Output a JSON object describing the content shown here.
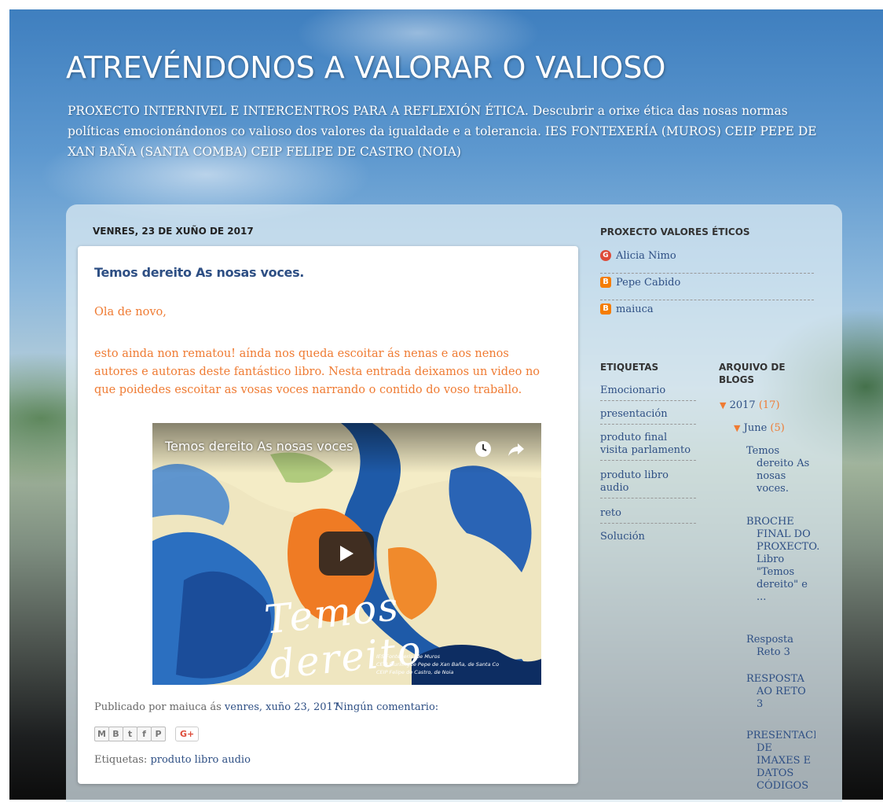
{
  "header": {
    "title": "ATREVÉNDONOS A VALORAR O VALIOSO",
    "description": "PROXECTO INTERNIVEL E INTERCENTROS PARA A REFLEXIÓN ÉTICA. Descubrir a orixe ética das nosas normas políticas emocionándonos co valioso dos valores da igualdade e a tolerancia. IES FONTEXERÍA (MUROS) CEIP PEPE DE XAN BAÑA (SANTA COMBA) CEIP FELIPE DE CASTRO (NOIA)"
  },
  "post": {
    "date_header": "VENRES, 23 DE XUÑO DE 2017",
    "title": "Temos dereito As nosas voces.",
    "paragraph1": "Ola de novo,",
    "paragraph2": "esto ainda non rematou! aínda nos queda escoitar ás nenas e aos nenos autores e autoras deste fantástico libro. Nesta entrada deixamos un video no que poidedes escoitar as vosas voces narrando o contido do voso traballo.",
    "video": {
      "title": "Temos dereito As nosas voces",
      "script_text": "Temos dereito",
      "credit1": "IES Fontexería, de Muros",
      "credit2": "CEIP Plurilingüe Pepe de Xan Baña, de Santa Co",
      "credit3": "CEIP Felipe de Castro, de Noia"
    },
    "footer": {
      "published_by": "Publicado por maiuca ás",
      "date_link": "venres, xuño 23, 2017",
      "comments": "Ningún comentario:"
    },
    "share_buttons": [
      "M",
      "B",
      "t",
      "f",
      "P"
    ],
    "gplus": "G+",
    "labels_prefix": "Etiquetas:",
    "labels_link": "produto libro audio"
  },
  "sidebar": {
    "authors_heading": "PROXECTO VALORES ÉTICOS",
    "authors": [
      {
        "name": "Alicia Nimo",
        "icon": "google-plus-icon"
      },
      {
        "name": "Pepe Cabido",
        "icon": "blogger-icon"
      },
      {
        "name": "maiuca",
        "icon": "blogger-icon"
      }
    ],
    "labels_heading": "ETIQUETAS",
    "labels": [
      "Emocionario",
      "presentación",
      "produto final visita parlamento",
      "produto libro audio",
      "reto",
      "Solución"
    ],
    "archive_heading": "ARQUIVO DE BLOGS",
    "archive": {
      "year": "2017",
      "year_count": "(17)",
      "month": "June",
      "month_count": "(5)",
      "posts": [
        "Temos dereito As nosas voces.",
        "BROCHE FINAL DO PROXECTO. Libro \"Temos dereito\" e ...",
        "Resposta Reto 3",
        "RESPOSTA AO RETO 3",
        "PRESENTACIÓN DE IMAXES E DATOS CÓDIGOS"
      ]
    }
  },
  "colors": {
    "link": "#2e4f84",
    "accent_orange": "#ef7b33",
    "post_bg": "#ffffff"
  }
}
